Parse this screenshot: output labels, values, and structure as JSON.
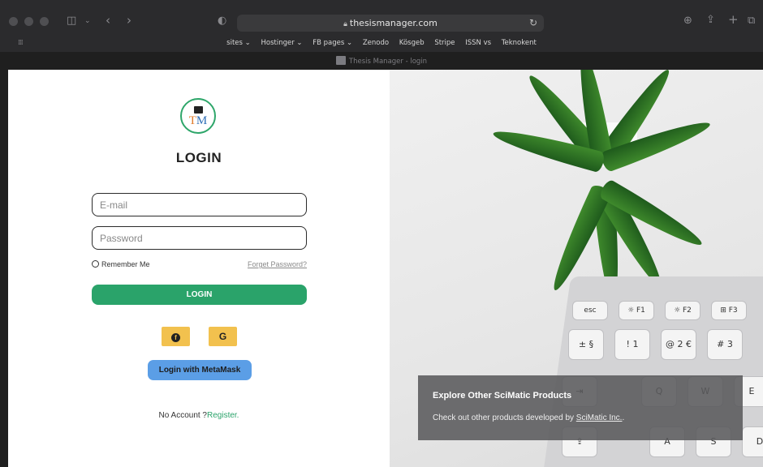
{
  "browser": {
    "url": "thesismanager.com",
    "tab_title": "Thesis Manager - login",
    "bookmarks": [
      "sites ⌄",
      "Hostinger ⌄",
      "FB pages ⌄",
      "Zenodo",
      "Kösgeb",
      "Stripe",
      "ISSN vs",
      "Teknokent"
    ],
    "icons": {
      "sidebar": "sidebar-icon",
      "back": "back-icon",
      "forward": "forward-icon",
      "shield": "shield-icon",
      "reload": "reload-icon",
      "download": "download-icon",
      "share": "share-icon",
      "new_tab": "plus-icon",
      "tabs": "tabs-icon"
    }
  },
  "login": {
    "logo_text_t": "T",
    "logo_text_m": "M",
    "title": "LOGIN",
    "email_placeholder": "E-mail",
    "password_placeholder": "Password",
    "remember_label": "Remember Me",
    "forgot_label": "Forget Password?",
    "submit_label": "LOGIN",
    "facebook_icon": "facebook-icon",
    "google_label": "G",
    "metamask_label": "Login with MetaMask",
    "no_account_label": "No Account ?",
    "register_label": "Register."
  },
  "promo": {
    "title": "Explore Other SciMatic Products",
    "text_prefix": "Check out other products developed by ",
    "link_label": "SciMatic Inc.",
    "text_suffix": "."
  },
  "keyboard": {
    "keys_row1": [
      "esc",
      "☼ F1",
      "☼ F2",
      "⊞ F3"
    ],
    "keys_row2": [
      "± §",
      "! 1",
      "@ 2 €",
      "# 3"
    ],
    "keys_row3": [
      "⇥",
      "Q",
      "W",
      "E"
    ],
    "keys_row4": [
      "⇪",
      "A",
      "S",
      "D"
    ]
  },
  "colors": {
    "accent_green": "#2aa36a",
    "social_yellow": "#f2c14e",
    "metamask_blue": "#5b9ee6",
    "chrome_dark": "#2b2b2d"
  }
}
